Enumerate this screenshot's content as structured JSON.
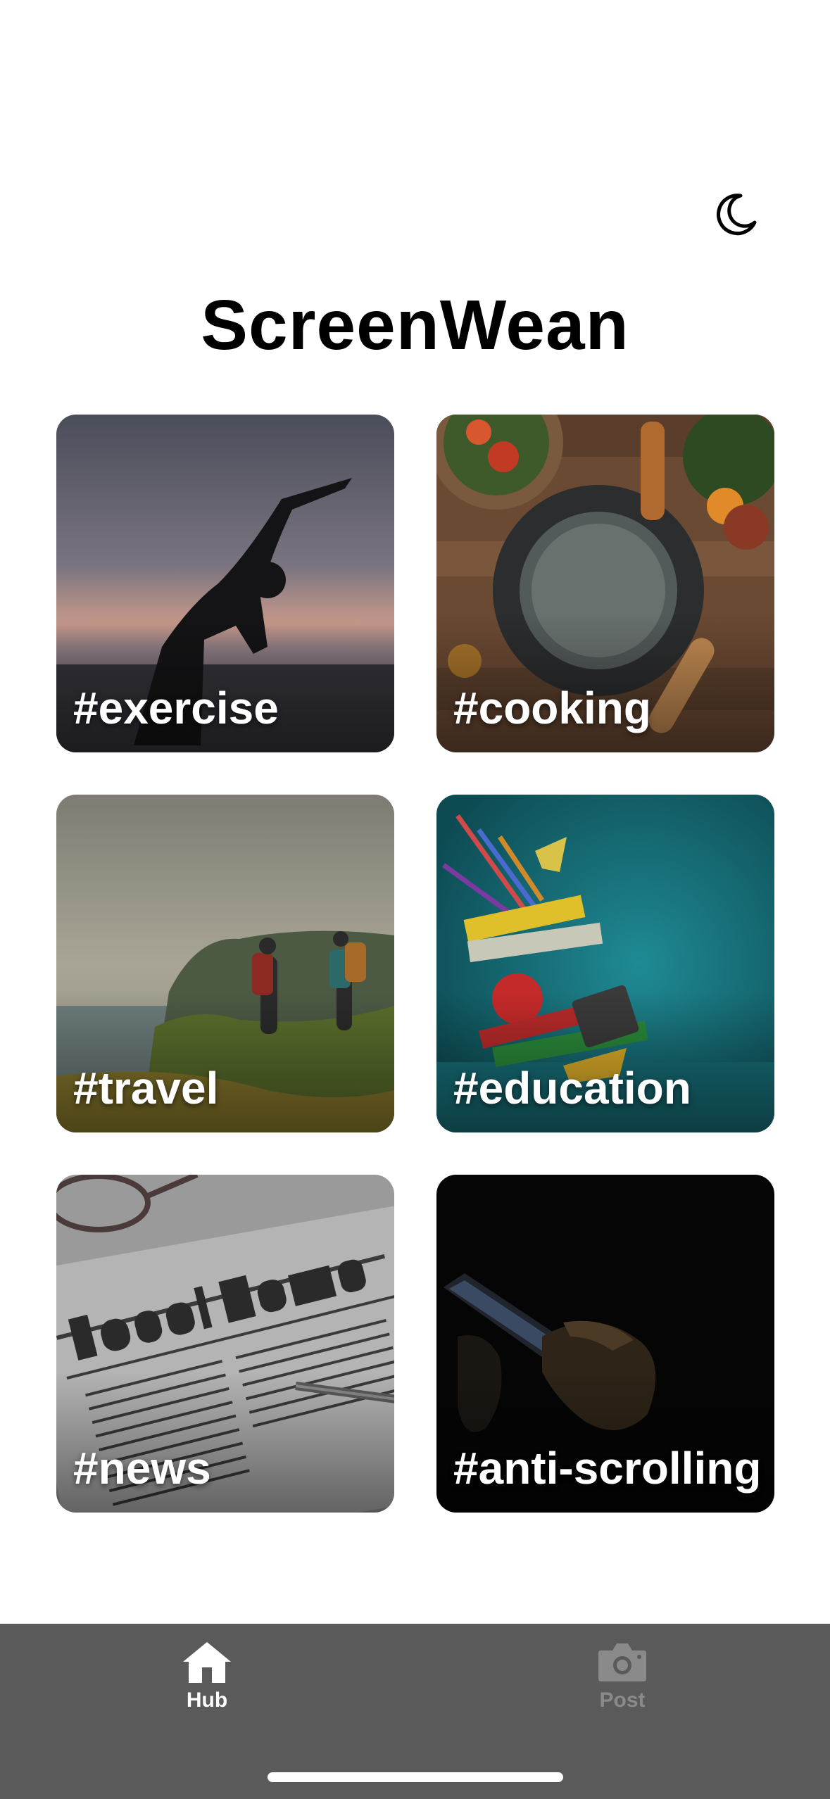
{
  "header": {
    "theme_toggle_icon": "moon-icon",
    "title": "ScreenWean"
  },
  "categories": [
    {
      "tag": "#exercise",
      "image": "yoga silhouette at sunset"
    },
    {
      "tag": "#cooking",
      "image": "pot and ingredients on wooden table"
    },
    {
      "tag": "#travel",
      "image": "hikers on coastal cliff"
    },
    {
      "tag": "#education",
      "image": "books, pencils and apple on teal"
    },
    {
      "tag": "#news",
      "image": "local news newspaper with glasses and pen"
    },
    {
      "tag": "#anti-scrolling",
      "image": "hand holding phone in the dark"
    }
  ],
  "tabbar": {
    "tabs": [
      {
        "label": "Hub",
        "icon": "home-icon",
        "active": true
      },
      {
        "label": "Post",
        "icon": "camera-icon",
        "active": false
      }
    ],
    "background": "#5a5a5a"
  },
  "colors": {
    "title": "#000000",
    "tag_text": "#ffffff",
    "tab_active": "#ffffff",
    "tab_inactive": "#8a8a8a"
  }
}
